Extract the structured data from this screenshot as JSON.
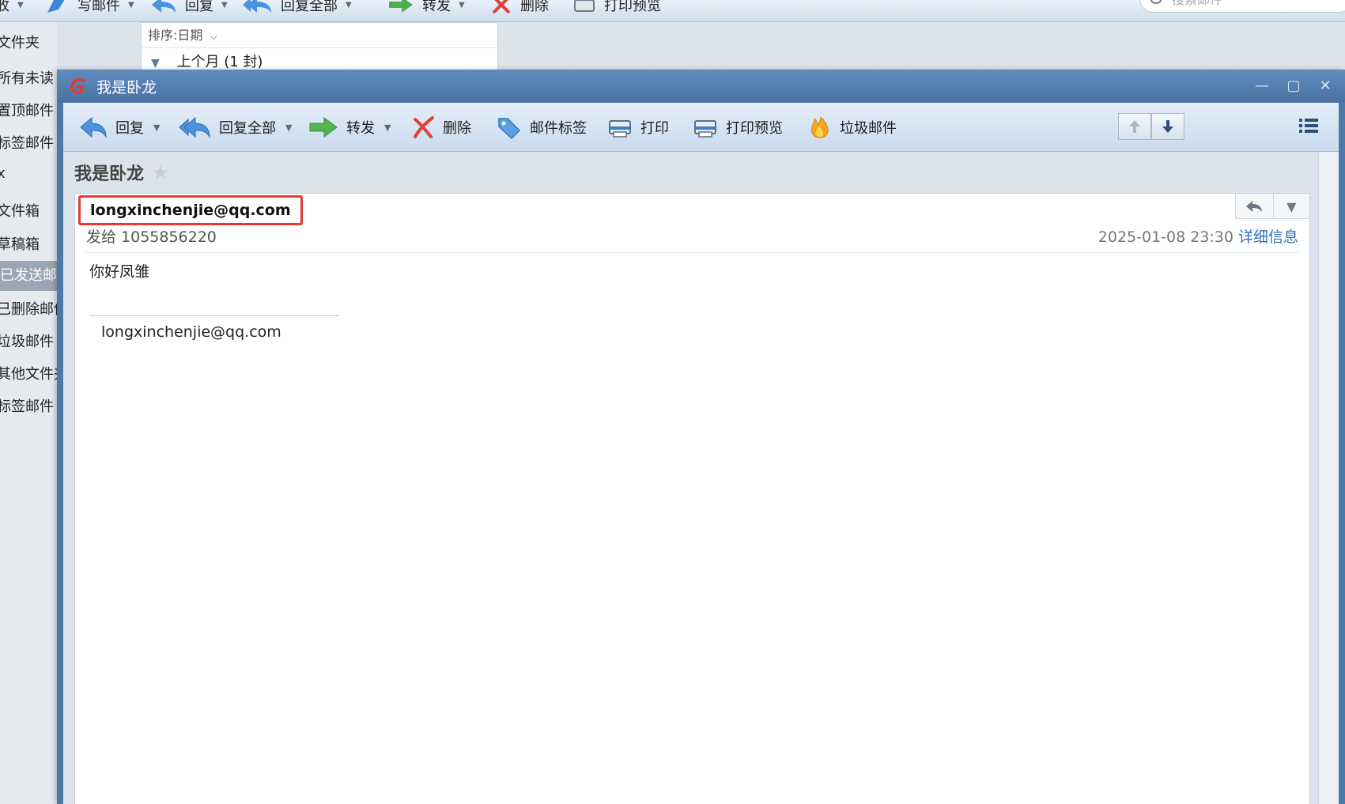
{
  "background": {
    "toolbar": {
      "items": [
        {
          "label": "收",
          "has_dropdown": true
        },
        {
          "label": "写邮件",
          "has_dropdown": true
        },
        {
          "label": "回复",
          "has_dropdown": true
        },
        {
          "label": "回复全部",
          "has_dropdown": true
        },
        {
          "label": "转发",
          "has_dropdown": true
        },
        {
          "label": "删除",
          "has_dropdown": false
        },
        {
          "label": "打印预览",
          "has_dropdown": false
        }
      ],
      "search_placeholder": "搜索邮件"
    },
    "sidebar": {
      "items": [
        {
          "label": "文件夹",
          "selected": false
        },
        {
          "label": "所有未读",
          "selected": false
        },
        {
          "label": "置顶邮件",
          "selected": false
        },
        {
          "label": "标签邮件",
          "selected": false
        },
        {
          "label": "x",
          "selected": false
        },
        {
          "label": "文件箱",
          "selected": false
        },
        {
          "label": "草稿箱",
          "selected": false
        },
        {
          "label": "已发送邮件",
          "selected": true
        },
        {
          "label": "已删除邮件",
          "selected": false
        },
        {
          "label": "垃圾邮件",
          "selected": false
        },
        {
          "label": "其他文件夹",
          "selected": false
        },
        {
          "label": "标签邮件",
          "selected": false
        }
      ]
    },
    "list": {
      "sort_label": "排序:日期",
      "group_label": "上个月 (1 封)"
    }
  },
  "window": {
    "title": "我是卧龙",
    "controls": {
      "minimize": "—",
      "maximize": "▢",
      "close": "✕"
    },
    "toolbar": {
      "reply": "回复",
      "reply_all": "回复全部",
      "forward": "转发",
      "delete": "删除",
      "tag": "邮件标签",
      "print": "打印",
      "print_preview": "打印预览",
      "spam": "垃圾邮件",
      "dropdown_glyph": "▼"
    },
    "message": {
      "subject": "我是卧龙",
      "star": "★",
      "sender": "longxinchenjie@qq.com",
      "recipient_label": "发给",
      "recipient": "1055856220",
      "date": "2025-01-08 23:30",
      "details_link": "详细信息",
      "body": "你好凤雏",
      "signature": "longxinchenjie@qq.com"
    },
    "colors": {
      "titlebar": "#4e78a8",
      "highlight_box": "#e53935",
      "link": "#2f6fbf"
    }
  }
}
